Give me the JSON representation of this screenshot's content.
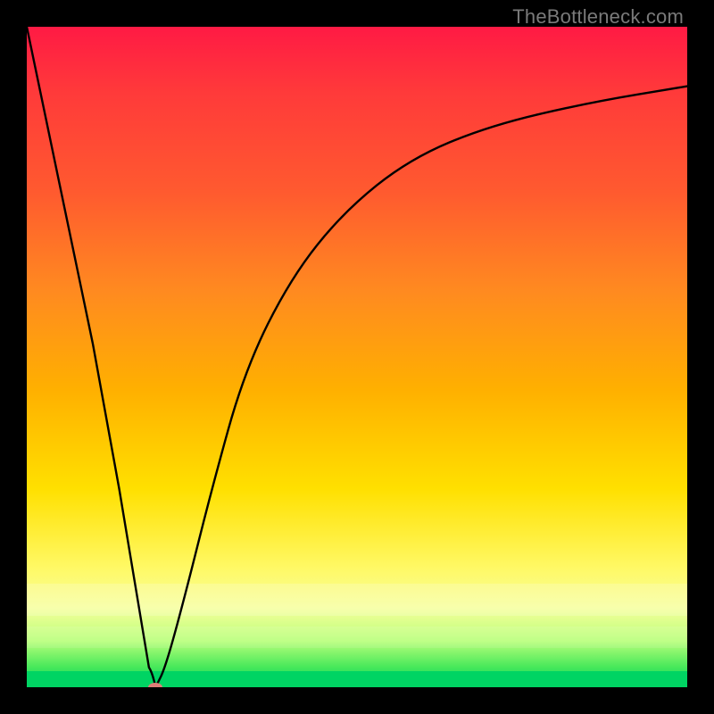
{
  "watermark": "TheBottleneck.com",
  "chart_data": {
    "type": "line",
    "title": "",
    "xlabel": "",
    "ylabel": "",
    "xlim": [
      0,
      100
    ],
    "ylim": [
      0,
      100
    ],
    "grid": false,
    "series": [
      {
        "name": "curve",
        "x": [
          0,
          5,
          10,
          14,
          17,
          18.5,
          19.5,
          21,
          24,
          28,
          33,
          40,
          48,
          58,
          70,
          85,
          100
        ],
        "y": [
          100,
          76,
          52,
          30,
          12,
          3,
          0,
          3,
          14,
          30,
          48,
          62,
          72,
          80,
          85,
          88.5,
          91
        ]
      }
    ],
    "marker": {
      "x": 19.5,
      "y": 0,
      "kind": "min"
    },
    "background_gradient": {
      "top": "#ff1a44",
      "bottom": "#00d463",
      "stops": [
        "#ff1a44",
        "#ff5a2f",
        "#ffb000",
        "#fff966",
        "#46e85a",
        "#00d463"
      ]
    }
  }
}
